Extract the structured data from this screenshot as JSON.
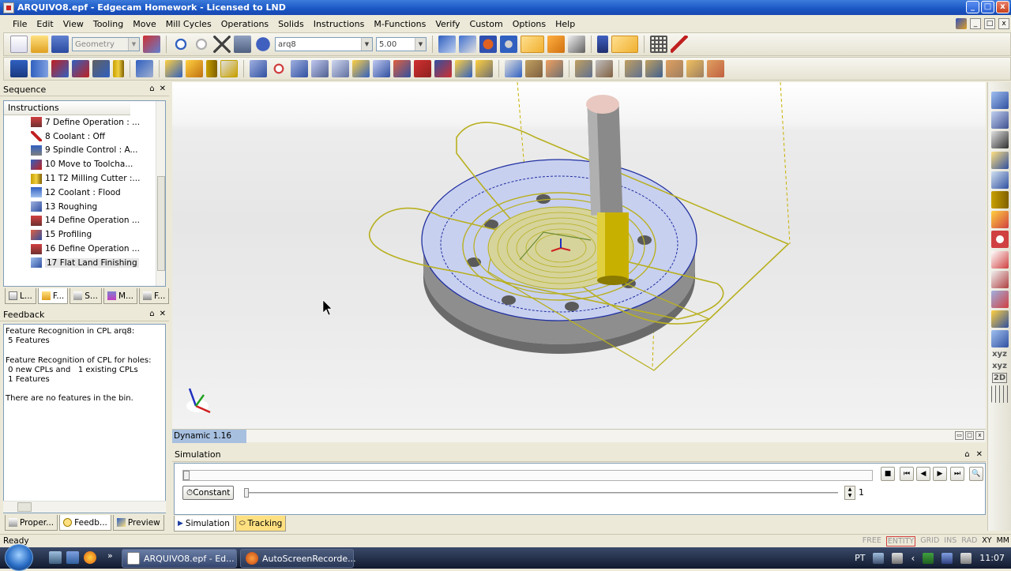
{
  "window": {
    "title": "ARQUIVO8.epf - Edgecam Homework - Licensed to LND",
    "controls": [
      "_",
      "□",
      "x"
    ]
  },
  "menu": [
    "File",
    "Edit",
    "View",
    "Tooling",
    "Move",
    "Mill Cycles",
    "Operations",
    "Solids",
    "Instructions",
    "M-Functions",
    "Verify",
    "Custom",
    "Options",
    "Help"
  ],
  "toolbar": {
    "geometry_combo": "Geometry",
    "cpl_combo": "arq8",
    "depth_combo": "5.00"
  },
  "sequence": {
    "title": "Sequence",
    "pin": "⌂",
    "close": "✕",
    "column": "Instructions",
    "items": [
      {
        "label": "7 Define Operation : ...",
        "icon": "define-operation-icon"
      },
      {
        "label": "8 Coolant : Off",
        "icon": "coolant-off-icon"
      },
      {
        "label": "9 Spindle Control : A...",
        "icon": "spindle-control-icon"
      },
      {
        "label": "10 Move to Toolcha...",
        "icon": "move-toolchange-icon"
      },
      {
        "label": "11 T2 Milling Cutter :...",
        "icon": "milling-cutter-icon"
      },
      {
        "label": "12 Coolant : Flood",
        "icon": "coolant-flood-icon"
      },
      {
        "label": "13 Roughing",
        "icon": "roughing-icon"
      },
      {
        "label": "14 Define Operation ...",
        "icon": "define-operation-icon"
      },
      {
        "label": "15 Profiling",
        "icon": "profiling-icon"
      },
      {
        "label": "16 Define Operation ...",
        "icon": "define-operation-icon"
      },
      {
        "label": "17 Flat Land Finishing",
        "icon": "flat-land-finishing-icon"
      }
    ],
    "tabs": [
      "L...",
      "F...",
      "S...",
      "M...",
      "F..."
    ]
  },
  "feedback": {
    "title": "Feedback",
    "lines": "Feature Recognition in CPL arq8:\n 5 Features\n\nFeature Recognition of CPL for holes:\n 0 new CPLs and   1 existing CPLs\n 1 Features\n\nThere are no features in the bin.",
    "tabs": [
      "Proper...",
      "Feedb...",
      "Preview"
    ]
  },
  "viewport": {
    "status": "Dynamic 1.16"
  },
  "simulation": {
    "title": "Simulation",
    "speed_mode": "Constant",
    "step_value": "1",
    "tabs": [
      "Simulation",
      "Tracking"
    ]
  },
  "right_toolbar": {
    "labels": [
      "xyz",
      "xyz",
      "2D"
    ]
  },
  "statusbar": {
    "ready": "Ready",
    "indicators": [
      "FREE",
      "ENTITY",
      "GRID",
      "INS",
      "RAD",
      "XY",
      "MM"
    ]
  },
  "taskbar": {
    "items": [
      {
        "label": "ARQUIVO8.epf - Ed...",
        "active": true
      },
      {
        "label": "AutoScreenRecorde...",
        "active": false
      }
    ],
    "quicklaunch_more": "»",
    "language": "PT",
    "clock": "11:07"
  },
  "colors": {
    "titlebar": "#1a56c4",
    "toolpath": "#b8b020",
    "stock": "#c8d0f0",
    "tool_upper": "#8a8a8a",
    "tool_lower": "#c8b000"
  }
}
